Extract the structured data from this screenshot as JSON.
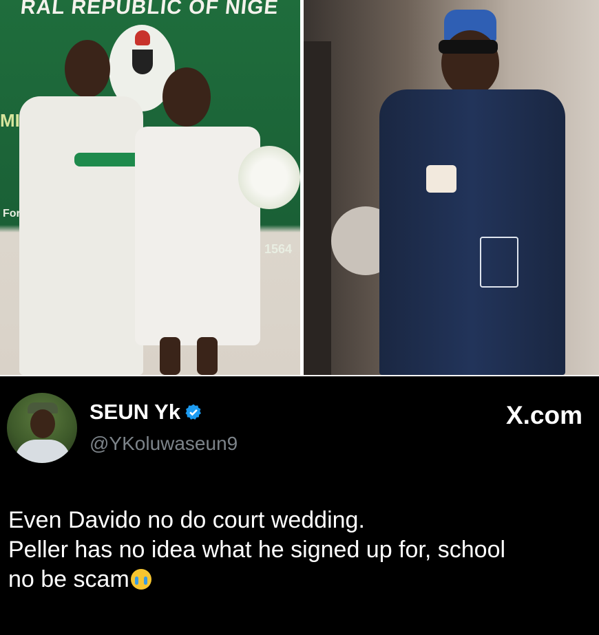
{
  "photos": {
    "left": {
      "banner_top": "RAL REPUBLIC OF NIGE",
      "banner_mid": "MI                     RIO",
      "banner_small": "For e",
      "banner_num": "1564"
    },
    "right": {}
  },
  "tweet": {
    "display_name": "SEUN Yk",
    "handle": "@YKoluwaseun9",
    "source": "X.com",
    "lines": [
      "Even Davido no do court wedding.",
      "Peller has no idea what he signed up for, school",
      "no be scam"
    ],
    "emoji_icon": "loudly-crying-face-icon",
    "verified_icon": "verified-badge-icon",
    "colors": {
      "background": "#000000",
      "text": "#ffffff",
      "handle": "#7c8389",
      "verified": "#1d9bf0"
    }
  }
}
